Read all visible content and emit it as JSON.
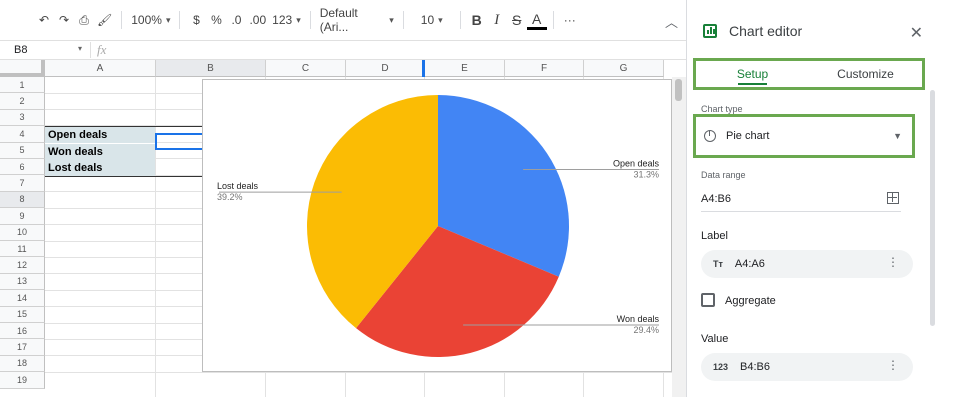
{
  "toolbar": {
    "zoom": "100%",
    "currency": "$",
    "percent": "%",
    "dec_less": ".0",
    "dec_more": ".00",
    "number_format": "123",
    "font": "Default (Ari...",
    "font_size": "10",
    "bold": "B",
    "italic": "I",
    "strike": "S",
    "text_color": "A",
    "more": "···"
  },
  "formula_bar": {
    "cell_ref": "B8",
    "fx": "fx"
  },
  "columns": [
    "A",
    "B",
    "C",
    "D",
    "E",
    "F",
    "G"
  ],
  "rows": [
    "1",
    "2",
    "3",
    "4",
    "5",
    "6",
    "7",
    "8",
    "9",
    "10",
    "11",
    "12",
    "13",
    "14",
    "15",
    "16",
    "17",
    "18",
    "19"
  ],
  "cells": {
    "a4": "Open deals",
    "a5": "Won deals",
    "a6": "Lost deals"
  },
  "chart_data": {
    "type": "pie",
    "categories": [
      "Open deals",
      "Won deals",
      "Lost deals"
    ],
    "values": [
      31.3,
      29.4,
      39.2
    ],
    "value_labels": [
      "31.3%",
      "29.4%",
      "39.2%"
    ],
    "colors": [
      "#4285f4",
      "#ea4335",
      "#fbbc04"
    ],
    "legend": "labeled slices"
  },
  "editor": {
    "title": "Chart editor",
    "tabs": [
      "Setup",
      "Customize"
    ],
    "chart_type_label": "Chart type",
    "chart_type_value": "Pie chart",
    "data_range_label": "Data range",
    "data_range_value": "A4:B6",
    "label_section": "Label",
    "label_value": "A4:A6",
    "label_icon": "Tт",
    "aggregate_label": "Aggregate",
    "value_section": "Value",
    "value_value": "B4:B6",
    "value_icon": "123"
  }
}
